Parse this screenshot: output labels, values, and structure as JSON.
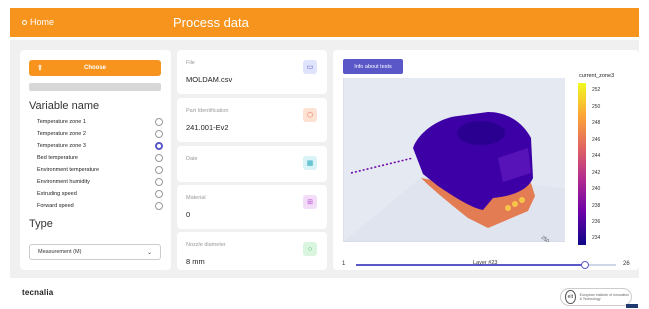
{
  "header": {
    "home_label": "Home",
    "title": "Process data"
  },
  "left": {
    "choose_label": "Choose",
    "variable_title": "Variable name",
    "variables": [
      {
        "label": "Temperature zone 1",
        "selected": false
      },
      {
        "label": "Temperature zone 2",
        "selected": false
      },
      {
        "label": "Temperature zone 3",
        "selected": true
      },
      {
        "label": "Bed temperature",
        "selected": false
      },
      {
        "label": "Environment temperature",
        "selected": false
      },
      {
        "label": "Environment humidity",
        "selected": false
      },
      {
        "label": "Extruding speed",
        "selected": false
      },
      {
        "label": "Forward speed",
        "selected": false
      }
    ],
    "type_title": "Type",
    "type_value": "Measurement (M)"
  },
  "info": {
    "file_label": "File",
    "file_value": "MOLDAM.csv",
    "part_label": "Part Identification",
    "part_value": "241.001-Ev2",
    "date_label": "Date",
    "date_value": "",
    "material_label": "Material",
    "material_value": "0",
    "nozzle_label": "Nozzle diameter",
    "nozzle_value": "8 mm"
  },
  "plot": {
    "info_button": "Info about tests",
    "colorbar_title": "current_zone3",
    "colorbar_ticks": [
      "252",
      "250",
      "248",
      "246",
      "244",
      "242",
      "240",
      "238",
      "236",
      "234"
    ],
    "slider_min": "1",
    "slider_max": "26",
    "slider_value": 23,
    "slider_label": "Layer #23"
  },
  "footer": {
    "brand": "tecnalia",
    "eit_logo": "eit",
    "eit_text": "European Institute of Innovation & Technology"
  },
  "colors": {
    "accent": "#f7941d",
    "primary": "#5a57c9"
  }
}
